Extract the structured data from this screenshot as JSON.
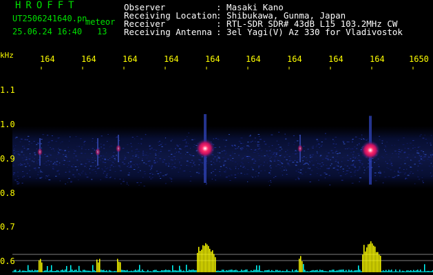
{
  "header": {
    "title": "HROFFT",
    "file_name": "UT2506241640.pn",
    "meteor_label": "meteor",
    "datetime": "25.06.24 16:40",
    "count": "13"
  },
  "info": {
    "observer_label": "Observer",
    "observer_value": ": Masaki Kano",
    "location_label": "Receiving Location",
    "location_value": ": Shibukawa, Gunma, Japan",
    "receiver_label": "Receiver",
    "receiver_value": ": RTL-SDR SDR# 43dB L15 103.2MHz CW",
    "antenna_label": "Receiving Antenna",
    "antenna_value": ": 3el Yagi(V) Az 330 for Vladivostok"
  },
  "axis": {
    "y_unit": "kHz",
    "x_ticks": [
      "164",
      "164",
      "164",
      "164",
      "164",
      "164",
      "164",
      "164",
      "164",
      "1650"
    ],
    "y_ticks": [
      "1.1",
      "1.0",
      "0.9",
      "0.8",
      "0.7",
      "0.6"
    ]
  },
  "colors": {
    "background": "#000000",
    "header_text": "#00e000",
    "info_text": "#ffffff",
    "tick_text": "#ffff00",
    "noise_band": "#1a2a7a",
    "echo_core": "#ff2a6a",
    "power_trace": "#00ffff",
    "power_burst": "#ffff00"
  },
  "chart_data": {
    "type": "heatmap",
    "y_unit": "kHz",
    "ylim": [
      0.57,
      1.2
    ],
    "noise_band": [
      0.82,
      0.98
    ],
    "echoes": [
      {
        "minute": 1645.2,
        "freq_khz": 0.93,
        "intensity": "strong"
      },
      {
        "minute": 1649.2,
        "freq_khz": 0.925,
        "intensity": "strong"
      },
      {
        "minute": 1643.1,
        "freq_khz": 0.93,
        "intensity": "weak"
      },
      {
        "minute": 1641.2,
        "freq_khz": 0.92,
        "intensity": "weak"
      },
      {
        "minute": 1647.5,
        "freq_khz": 0.93,
        "intensity": "weak"
      },
      {
        "minute": 1642.6,
        "freq_khz": 0.92,
        "intensity": "weak"
      }
    ]
  }
}
